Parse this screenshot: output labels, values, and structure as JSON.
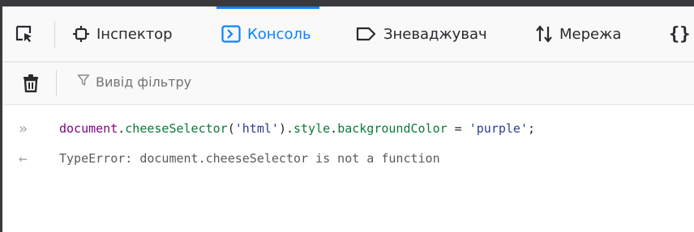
{
  "tabs": [
    {
      "label": "",
      "icon": "element-picker-icon"
    },
    {
      "label": "Інспектор",
      "icon": "inspector-icon"
    },
    {
      "label": "Консоль",
      "icon": "console-icon",
      "active": true
    },
    {
      "label": "Зневаджувач",
      "icon": "debugger-icon"
    },
    {
      "label": "Мережа",
      "icon": "network-icon"
    },
    {
      "label": "",
      "icon": "style-editor-icon"
    }
  ],
  "toolbar": {
    "filter_placeholder": "Вивід фільтру"
  },
  "console": {
    "input_tokens": {
      "t1": "document",
      "t2": ".",
      "t3": "cheeseSelector",
      "t4": "(",
      "t5": "'html'",
      "t6": ").",
      "t7": "style",
      "t8": ".",
      "t9": "backgroundColor",
      "t10": " = ",
      "t11": "'purple'",
      "t12": ";"
    },
    "error": "TypeError: document.cheeseSelector is not a function"
  },
  "colors": {
    "accent": "#0a84ff",
    "dark_frame": "#3a3a3d"
  }
}
